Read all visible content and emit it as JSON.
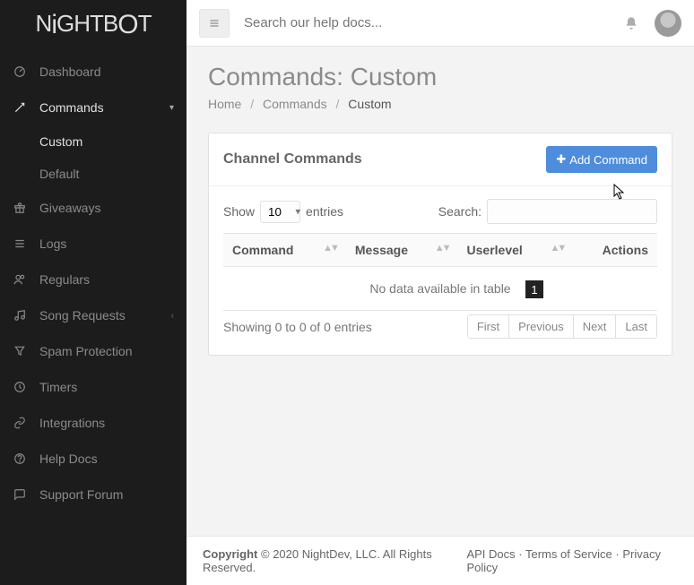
{
  "logo_text_1": "N",
  "logo_text_2": "i",
  "logo_text_3": "GHTB",
  "logo_text_4": "O",
  "logo_text_5": "T",
  "topbar": {
    "search_placeholder": "Search our help docs..."
  },
  "sidebar": {
    "items": [
      {
        "label": "Dashboard"
      },
      {
        "label": "Commands"
      },
      {
        "label": "Giveaways"
      },
      {
        "label": "Logs"
      },
      {
        "label": "Regulars"
      },
      {
        "label": "Song Requests"
      },
      {
        "label": "Spam Protection"
      },
      {
        "label": "Timers"
      },
      {
        "label": "Integrations"
      },
      {
        "label": "Help Docs"
      },
      {
        "label": "Support Forum"
      }
    ],
    "commands_sub": [
      {
        "label": "Custom"
      },
      {
        "label": "Default"
      }
    ]
  },
  "page": {
    "title": "Commands: Custom",
    "crumb_home": "Home",
    "crumb_commands": "Commands",
    "crumb_current": "Custom"
  },
  "panel": {
    "title": "Channel Commands",
    "add_label": "Add Command",
    "show_text": "Show",
    "entries_text": "entries",
    "length_value": "10",
    "search_label": "Search:",
    "columns": {
      "command": "Command",
      "message": "Message",
      "userlevel": "Userlevel",
      "actions": "Actions"
    },
    "empty_text": "No data available in table",
    "info_text": "Showing 0 to 0 of 0 entries",
    "pager": {
      "first": "First",
      "previous": "Previous",
      "next": "Next",
      "last": "Last"
    }
  },
  "footer": {
    "copyright_strong": "Copyright",
    "copyright_rest": " © 2020 NightDev, LLC. All Rights Reserved.",
    "api_docs": "API Docs",
    "tos": "Terms of Service",
    "privacy": "Privacy Policy",
    "dot": " · "
  },
  "overlay": {
    "step": "1"
  }
}
